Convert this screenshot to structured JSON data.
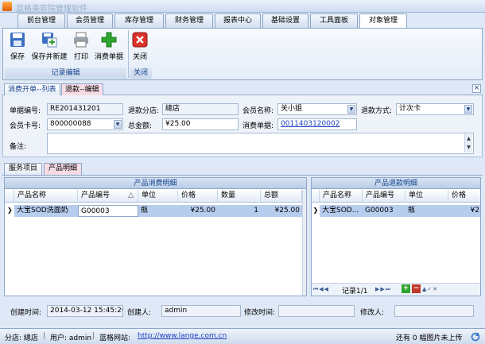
{
  "app": {
    "title": "蓝格美容院管理软件"
  },
  "tabs": [
    "前台管理",
    "会员管理",
    "库存管理",
    "财务管理",
    "报表中心",
    "基础设置",
    "工具面板",
    "对象管理"
  ],
  "ribbon": {
    "save": "保存",
    "save_new": "保存并新建",
    "print": "打印",
    "consume_doc": "消费单据",
    "close": "关闭",
    "group_record": "记录编辑",
    "group_close": "关闭"
  },
  "doc_tabs": [
    "消费开单--列表",
    "退款--编辑"
  ],
  "form": {
    "doc_no_label": "单据编号:",
    "doc_no": "RE201431201",
    "branch_label": "退款分店:",
    "branch": "總店",
    "member_name_label": "会员名称:",
    "member_name": "关小姐",
    "refund_method_label": "退款方式:",
    "refund_method": "计次卡",
    "card_no_label": "会员卡号:",
    "card_no": "800000088",
    "total_label": "总金额:",
    "total": "¥25.00",
    "consume_doc_label": "消费单据:",
    "consume_doc": "0011403120002",
    "remark_label": "备注:",
    "remark": ""
  },
  "sub_tabs": [
    "服务项目",
    "产品明细"
  ],
  "consume_grid": {
    "title": "产品消费明细",
    "columns": [
      "产品名称",
      "产品编号",
      "单位",
      "价格",
      "数量",
      "总额"
    ],
    "rows": [
      {
        "name": "大宝SOD洗面奶",
        "code": "G00003",
        "unit": "瓶",
        "price": "¥25.00",
        "qty": "1",
        "amount": "¥25.00"
      }
    ]
  },
  "refund_grid": {
    "title": "产品退款明细",
    "columns": [
      "产品名称",
      "产品编号",
      "单位",
      "价格"
    ],
    "rows": [
      {
        "name": "大宝SOD...",
        "code": "G00003",
        "unit": "瓶",
        "price": "¥2"
      }
    ],
    "pager": "记录1/1"
  },
  "meta": {
    "created_time_label": "创建时间:",
    "created_time": "2014-03-12 15:45:20",
    "creator_label": "创建人:",
    "creator": "admin",
    "modified_time_label": "修改时间:",
    "modified_time": "",
    "modifier_label": "修改人:",
    "modifier": ""
  },
  "status": {
    "branch": "分店: 總店",
    "user": "用户: admin",
    "site_label": "蓝格网站:",
    "site": "http://www.lange.com.cn",
    "unread": "还有 0 幅图片未上传"
  },
  "colors": {
    "accent": "#15428b",
    "selected_row": "#b7cdee",
    "link": "#1a3fbf"
  }
}
